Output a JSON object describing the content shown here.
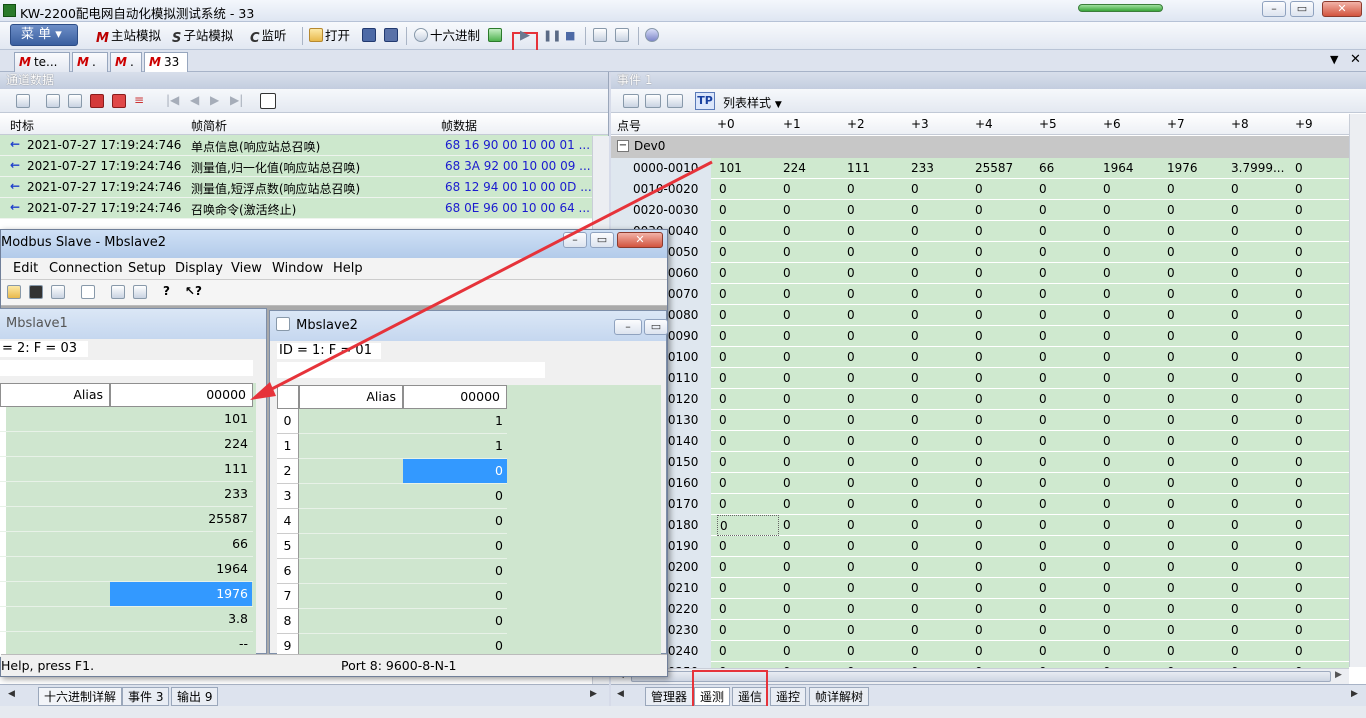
{
  "app": {
    "title": "KW-2200配电网自动化模拟测试系统 - 33"
  },
  "toolbar": {
    "menu": "菜 单",
    "master_sim": "主站模拟",
    "sub_sim": "子站模拟",
    "monitor": "监听",
    "open": "打开",
    "hex": "十六进制"
  },
  "doc_tabs": [
    {
      "label": "te..."
    },
    {
      "label": "."
    },
    {
      "label": "."
    },
    {
      "label": "33"
    }
  ],
  "left_panel": {
    "header": "通道数据",
    "columns": [
      "时标",
      "帧简析",
      "帧数据"
    ],
    "rows": [
      {
        "time": "2021-07-27 17:19:24:746",
        "desc": "单点信息(响应站总召唤)",
        "data": "68 16 90 00 10 00 01 ..."
      },
      {
        "time": "2021-07-27 17:19:24:746",
        "desc": "测量值,归一化值(响应站总召唤)",
        "data": "68 3A 92 00 10 00 09 ..."
      },
      {
        "time": "2021-07-27 17:19:24:746",
        "desc": "测量值,短浮点数(响应站总召唤)",
        "data": "68 12 94 00 10 00 0D ..."
      },
      {
        "time": "2021-07-27 17:19:24:746",
        "desc": "召唤命令(激活终止)",
        "data": "68 0E 96 00 10 00 64 ..."
      }
    ],
    "bottom_tabs": [
      "十六进制详解",
      "事件 3",
      "输出 9"
    ]
  },
  "right_panel": {
    "header": "事件 1",
    "list_style": "列表样式",
    "tp": "TP",
    "columns": [
      "点号",
      "+0",
      "+1",
      "+2",
      "+3",
      "+4",
      "+5",
      "+6",
      "+7",
      "+8",
      "+9"
    ],
    "group": "Dev0",
    "rows": [
      {
        "label": "0000-0010",
        "values": [
          "101",
          "224",
          "111",
          "233",
          "25587",
          "66",
          "1964",
          "1976",
          "3.7999...",
          "0"
        ]
      },
      {
        "label": "0010-0020",
        "values": [
          "0",
          "0",
          "0",
          "0",
          "0",
          "0",
          "0",
          "0",
          "0",
          "0"
        ]
      },
      {
        "label": "0020-0030",
        "values": [
          "0",
          "0",
          "0",
          "0",
          "0",
          "0",
          "0",
          "0",
          "0",
          "0"
        ]
      },
      {
        "label": "0030-0040",
        "values": [
          "0",
          "0",
          "0",
          "0",
          "0",
          "0",
          "0",
          "0",
          "0",
          "0"
        ]
      },
      {
        "label": "0040-0050",
        "values": [
          "0",
          "0",
          "0",
          "0",
          "0",
          "0",
          "0",
          "0",
          "0",
          "0"
        ]
      },
      {
        "label": "0050-0060",
        "values": [
          "0",
          "0",
          "0",
          "0",
          "0",
          "0",
          "0",
          "0",
          "0",
          "0"
        ]
      },
      {
        "label": "0060-0070",
        "values": [
          "0",
          "0",
          "0",
          "0",
          "0",
          "0",
          "0",
          "0",
          "0",
          "0"
        ]
      },
      {
        "label": "0070-0080",
        "values": [
          "0",
          "0",
          "0",
          "0",
          "0",
          "0",
          "0",
          "0",
          "0",
          "0"
        ]
      },
      {
        "label": "0080-0090",
        "values": [
          "0",
          "0",
          "0",
          "0",
          "0",
          "0",
          "0",
          "0",
          "0",
          "0"
        ]
      },
      {
        "label": "0090-0100",
        "values": [
          "0",
          "0",
          "0",
          "0",
          "0",
          "0",
          "0",
          "0",
          "0",
          "0"
        ]
      },
      {
        "label": "0100-0110",
        "values": [
          "0",
          "0",
          "0",
          "0",
          "0",
          "0",
          "0",
          "0",
          "0",
          "0"
        ]
      },
      {
        "label": "0110-0120",
        "values": [
          "0",
          "0",
          "0",
          "0",
          "0",
          "0",
          "0",
          "0",
          "0",
          "0"
        ]
      },
      {
        "label": "0120-0130",
        "values": [
          "0",
          "0",
          "0",
          "0",
          "0",
          "0",
          "0",
          "0",
          "0",
          "0"
        ]
      },
      {
        "label": "0130-0140",
        "values": [
          "0",
          "0",
          "0",
          "0",
          "0",
          "0",
          "0",
          "0",
          "0",
          "0"
        ]
      },
      {
        "label": "0140-0150",
        "values": [
          "0",
          "0",
          "0",
          "0",
          "0",
          "0",
          "0",
          "0",
          "0",
          "0"
        ]
      },
      {
        "label": "0150-0160",
        "values": [
          "0",
          "0",
          "0",
          "0",
          "0",
          "0",
          "0",
          "0",
          "0",
          "0"
        ]
      },
      {
        "label": "0160-0170",
        "values": [
          "0",
          "0",
          "0",
          "0",
          "0",
          "0",
          "0",
          "0",
          "0",
          "0"
        ]
      },
      {
        "label": "0170-0180",
        "values": [
          "0",
          "0",
          "0",
          "0",
          "0",
          "0",
          "0",
          "0",
          "0",
          "0"
        ]
      },
      {
        "label": "0180-0190",
        "values": [
          "0",
          "0",
          "0",
          "0",
          "0",
          "0",
          "0",
          "0",
          "0",
          "0"
        ]
      },
      {
        "label": "0190-0200",
        "values": [
          "0",
          "0",
          "0",
          "0",
          "0",
          "0",
          "0",
          "0",
          "0",
          "0"
        ]
      },
      {
        "label": "0200-0210",
        "values": [
          "0",
          "0",
          "0",
          "0",
          "0",
          "0",
          "0",
          "0",
          "0",
          "0"
        ]
      },
      {
        "label": "0210-0220",
        "values": [
          "0",
          "0",
          "0",
          "0",
          "0",
          "0",
          "0",
          "0",
          "0",
          "0"
        ]
      },
      {
        "label": "0220-0230",
        "values": [
          "0",
          "0",
          "0",
          "0",
          "0",
          "0",
          "0",
          "0",
          "0",
          "0"
        ]
      },
      {
        "label": "0230-0240",
        "values": [
          "0",
          "0",
          "0",
          "0",
          "0",
          "0",
          "0",
          "0",
          "0",
          "0"
        ]
      },
      {
        "label": "0240-0250",
        "values": [
          "0",
          "0",
          "0",
          "0",
          "0",
          "0",
          "0",
          "0",
          "0",
          "0"
        ]
      }
    ],
    "bottom_tabs": [
      "管理器",
      "遥测",
      "遥信",
      "遥控",
      "帧详解树"
    ]
  },
  "modbus": {
    "title": "Modbus Slave - Mbslave2",
    "menu": [
      "Edit",
      "Connection",
      "Setup",
      "Display",
      "View",
      "Window",
      "Help"
    ],
    "child1": {
      "title": "Mbslave1",
      "id": "= 2: F = 03",
      "col_alias": "Alias",
      "col_addr": "00000",
      "values": [
        "101",
        "224",
        "111",
        "233",
        "25587",
        "66",
        "1964",
        "1976",
        "3.8",
        "--"
      ]
    },
    "child2": {
      "title": "Mbslave2",
      "id": "ID = 1: F = 01",
      "col_alias": "Alias",
      "col_addr": "00000",
      "rows": [
        "0",
        "1",
        "2",
        "3",
        "4",
        "5",
        "6",
        "7",
        "8",
        "9"
      ],
      "values": [
        "1",
        "1",
        "0",
        "0",
        "0",
        "0",
        "0",
        "0",
        "0",
        "0"
      ]
    },
    "status_left": "Help, press F1.",
    "status_right": "Port 8: 9600-8-N-1"
  },
  "colors": {
    "accent_red": "#e6333a",
    "grid_green": "#cfe9cf",
    "select_blue": "#3399ff"
  }
}
